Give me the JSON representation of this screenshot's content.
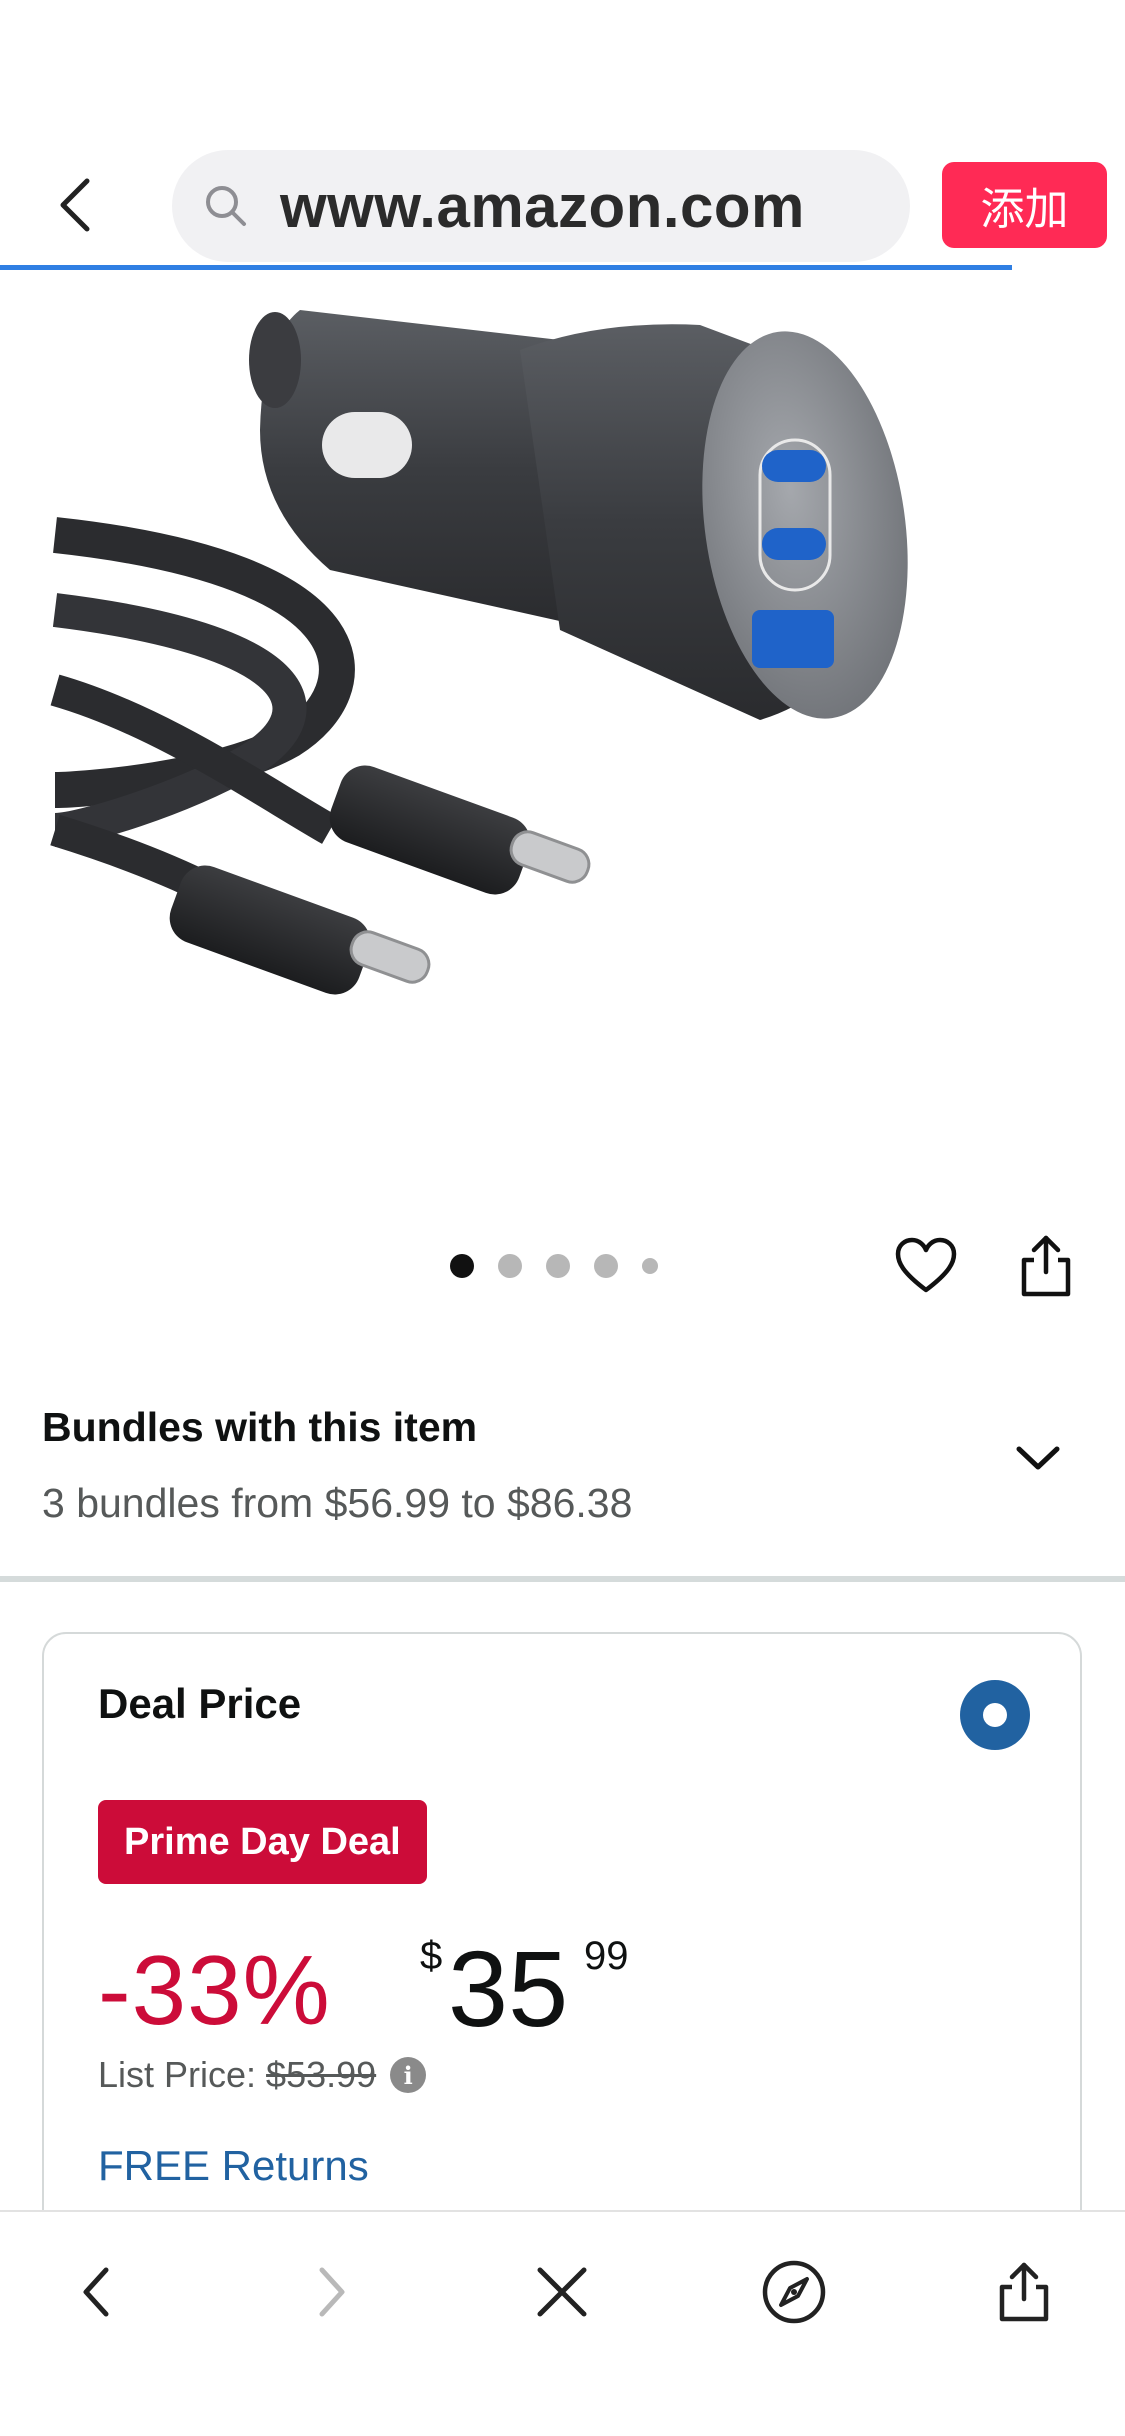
{
  "browser": {
    "url": "www.amazon.com",
    "add_button_label": "添加",
    "back_icon": "chevron-left-icon",
    "search_icon": "search-icon",
    "accent_color": "#ff2a55",
    "progress_color": "#2f7fe3"
  },
  "gallery": {
    "image_count": 5,
    "active_index": 0
  },
  "bundles": {
    "title": "Bundles with this item",
    "summary": "3 bundles from $56.99 to $86.38"
  },
  "deal": {
    "label": "Deal Price",
    "selected": true,
    "badge": "Prime Day Deal",
    "discount": "-33%",
    "currency": "$",
    "price_whole": "35",
    "price_fraction": "99",
    "list_price_label": "List Price:",
    "list_price": "$53.99",
    "info_icon": "i",
    "returns": "FREE Returns",
    "badge_color": "#cc0c39",
    "link_color": "#2162a1"
  },
  "toolbar": {
    "items": [
      "back-icon",
      "forward-icon",
      "close-icon",
      "compass-icon",
      "share-icon"
    ]
  }
}
